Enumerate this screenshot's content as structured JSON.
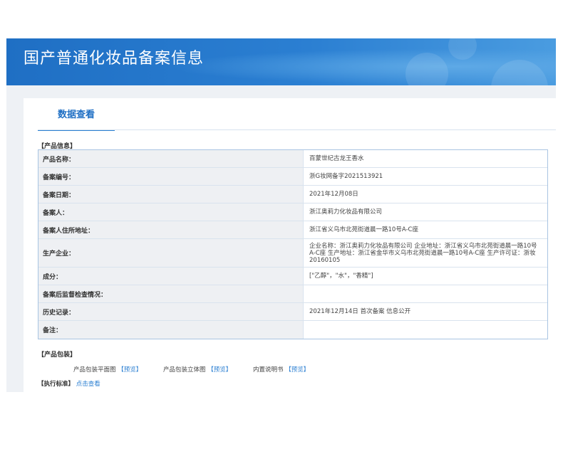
{
  "header": {
    "title": "国产普通化妆品备案信息"
  },
  "tab": {
    "label": "数据查看"
  },
  "product_info": {
    "section_title": "【产品信息】",
    "rows": [
      {
        "label": "产品名称：",
        "value": "百蒙世纪古龙王香水"
      },
      {
        "label": "备案编号：",
        "value": "浙G妆网备字2021513921"
      },
      {
        "label": "备案日期：",
        "value": "2021年12月08日"
      },
      {
        "label": "备案人：",
        "value": "浙江奥莉力化妆品有限公司"
      },
      {
        "label": "备案人住所地址：",
        "value": "浙江省义乌市北苑街道晨一路10号A-C座"
      },
      {
        "label": "生产企业：",
        "value": "企业名称：浙江奥莉力化妆品有限公司 企业地址：浙江省义乌市北苑街道晨一路10号A-C座 生产地址：浙江省金华市义乌市北苑街道晨一路10号A-C座 生产许可证：浙妆20160105"
      },
      {
        "label": "成分：",
        "value": "[\"乙醇\"，\"水\"，\"香精\"]"
      },
      {
        "label": "备案后监督检查情况：",
        "value": ""
      },
      {
        "label": "历史记录：",
        "value": "2021年12月14日 首次备案 信息公开"
      },
      {
        "label": "备注：",
        "value": ""
      }
    ]
  },
  "packaging": {
    "section_title": "【产品包装】",
    "items": [
      {
        "label": "产品包装平面图",
        "link": "预览"
      },
      {
        "label": "产品包装立体图",
        "link": "预览"
      },
      {
        "label": "内置说明书",
        "link": "预览"
      }
    ]
  },
  "standard": {
    "section_title": "【执行标准】",
    "link": "点击查看"
  },
  "colors": {
    "banner": "#2b7fd2",
    "accent": "#1f6fc4",
    "link": "#2b7fd2"
  }
}
